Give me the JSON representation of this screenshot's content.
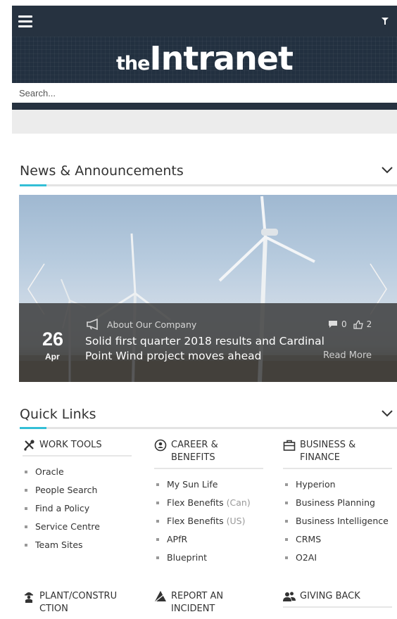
{
  "header": {
    "logo_the": "the",
    "logo_main": "Intranet",
    "search_placeholder": "Search..."
  },
  "news": {
    "title": "News & Announcements",
    "slide": {
      "category": "About Our Company",
      "day": "26",
      "month": "Apr",
      "headline": "Solid first quarter 2018 results and Cardinal Point Wind project moves ahead",
      "comments": "0",
      "likes": "2",
      "read_more": "Read More"
    }
  },
  "quick_links": {
    "title": "Quick Links",
    "columns": [
      {
        "icon": "tools-icon",
        "label": "WORK TOOLS",
        "links": [
          "Oracle",
          "People Search",
          "Find a Policy",
          "Service Centre",
          "Team Sites"
        ]
      },
      {
        "icon": "career-icon",
        "label": "CAREER &\nBENEFITS",
        "links": [
          "My Sun Life",
          "Flex Benefits",
          "Flex Benefits",
          "APfR",
          "Blueprint"
        ],
        "link_suffixes": [
          "",
          "(Can)",
          "(US)",
          "",
          ""
        ]
      },
      {
        "icon": "briefcase-icon",
        "label": "BUSINESS &\nFINANCE",
        "links": [
          "Hyperion",
          "Business Planning",
          "Business Intelligence",
          "CRMS",
          "O2AI"
        ]
      }
    ],
    "second_row": [
      {
        "icon": "worker-icon",
        "label": "PLANT/CONSTRU\nCTION"
      },
      {
        "icon": "warning-icon",
        "label": "REPORT AN\nINCIDENT"
      },
      {
        "icon": "people-icon",
        "label": "GIVING BACK"
      }
    ]
  },
  "colors": {
    "header_bg": "#263240",
    "accent": "#33bfd6"
  }
}
